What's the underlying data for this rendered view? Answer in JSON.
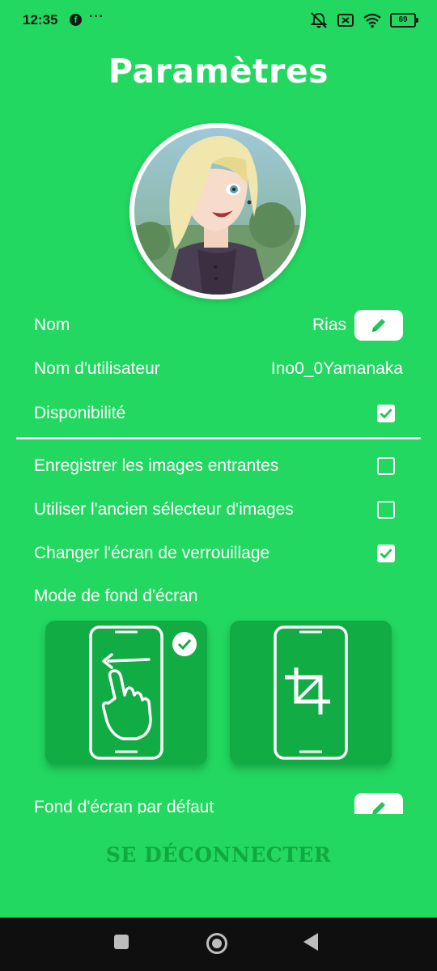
{
  "status_bar": {
    "time": "12:35",
    "icons": [
      "facebook-icon",
      "more-dots-icon",
      "mute-icon",
      "sim-off-icon",
      "wifi-icon",
      "battery-icon"
    ],
    "facebook_glyph": "f",
    "dots": "···",
    "battery_level": "69"
  },
  "header": {
    "title": "Paramètres"
  },
  "profile": {
    "name_label": "Nom",
    "name_value": "Rias",
    "username_label": "Nom d'utilisateur",
    "username_value": "Ino0_0Yamanaka",
    "availability_label": "Disponibilité",
    "availability_checked": true
  },
  "settings": {
    "save_incoming_images_label": "Enregistrer les images entrantes",
    "save_incoming_images_checked": false,
    "old_image_picker_label": "Utiliser l'ancien sélecteur d'images",
    "old_image_picker_checked": false,
    "change_lock_screen_label": "Changer l'écran de verrouillage",
    "change_lock_screen_checked": true,
    "wallpaper_mode_label": "Mode de fond d'écran",
    "wallpaper_modes": [
      {
        "icon": "swipe-hand-icon",
        "selected": true
      },
      {
        "icon": "crop-icon",
        "selected": false
      }
    ],
    "default_wallpaper_label": "Fond d'écran par défaut"
  },
  "actions": {
    "logout_label": "SE DÉCONNECTER"
  },
  "colors": {
    "background": "#22d860",
    "card": "#12ac44",
    "logout_text": "#11a83f",
    "accent": "#21c655",
    "nav_bar": "#0f0f0f"
  }
}
